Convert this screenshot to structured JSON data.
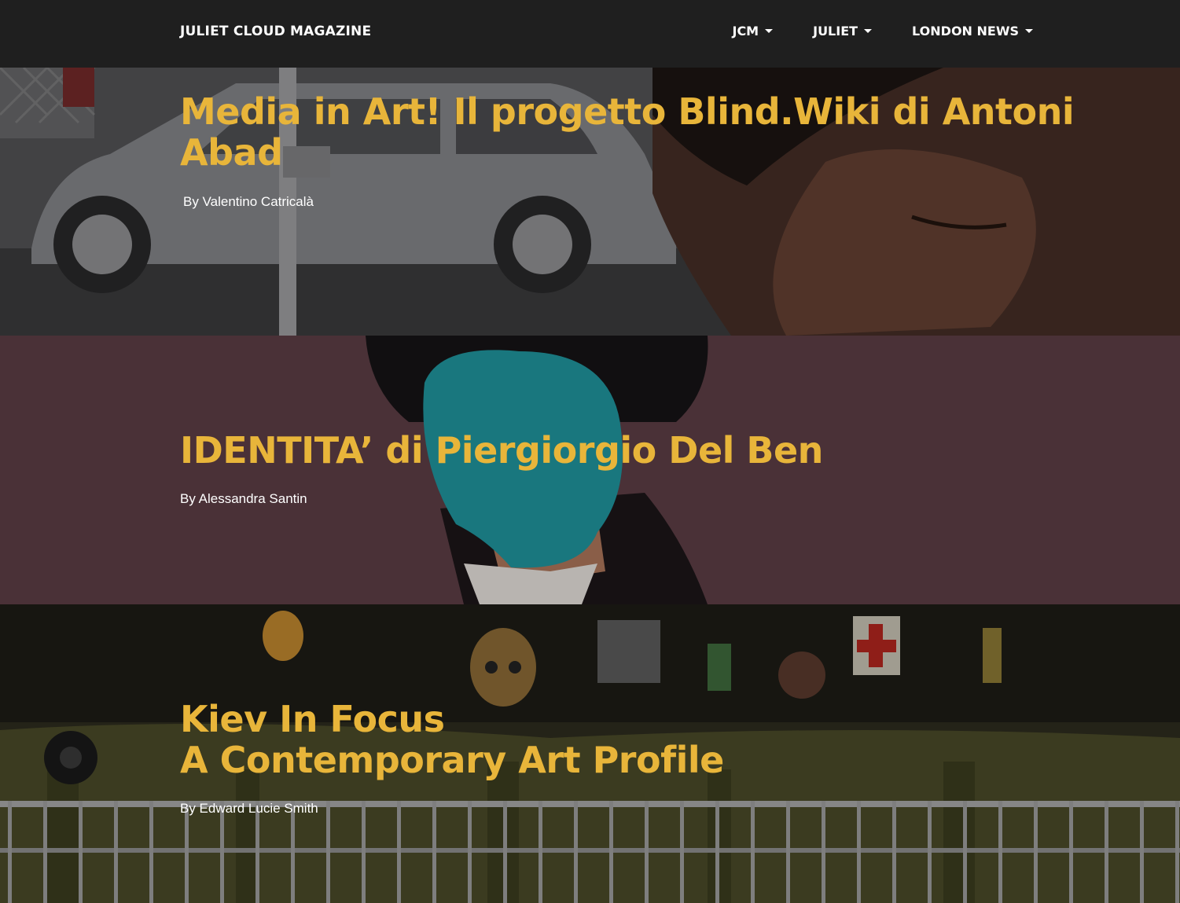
{
  "navbar": {
    "brand": "JULIET CLOUD MAGAZINE",
    "items": [
      {
        "label": "JCM"
      },
      {
        "label": "JULIET"
      },
      {
        "label": "LONDON NEWS"
      }
    ]
  },
  "articles": [
    {
      "title": "Media in Art! Il progetto Blind.Wiki di Antoni Abad",
      "author": "By Valentino Catricalà"
    },
    {
      "title": "IDENTITA’ di Piergiorgio Del Ben",
      "author": "By Alessandra Santin"
    },
    {
      "title": "Kiev In Focus\nA Contemporary Art Profile",
      "author": "By Edward Lucie Smith"
    }
  ],
  "colors": {
    "title": "#e8b53a",
    "navbar": "#1f1f1f",
    "hero2_bg": "#573a41"
  }
}
